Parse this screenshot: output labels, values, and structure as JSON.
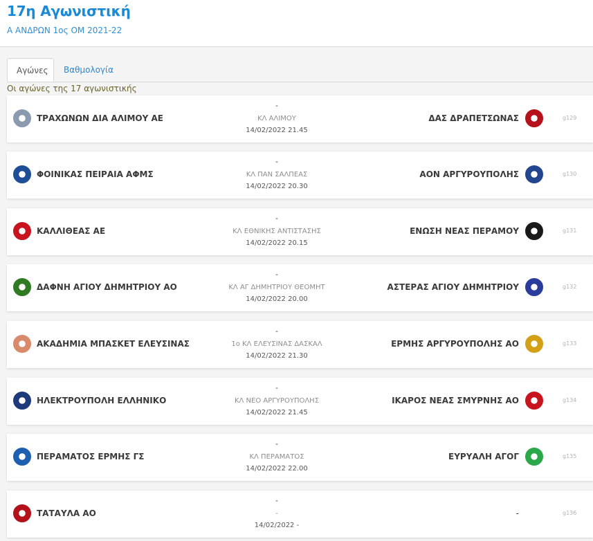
{
  "header": {
    "title": "17η Αγωνιστική",
    "subtitle": "Α ΑΝΔΡΩΝ 1ος ΟΜ 2021-22"
  },
  "tabs": [
    {
      "label": "Αγώνες",
      "active": true
    },
    {
      "label": "Βαθμολογία",
      "active": false
    }
  ],
  "games_caption": "Οι αγώνες της 17 αγωνιστικής",
  "matches": [
    {
      "home": "ΤΡΑΧΩΝΩΝ ΔΙΑ ΑΛΙΜΟΥ ΑΕ",
      "away": "ΔΑΣ ΔΡΑΠΕΤΣΩΝΑΣ",
      "score": "-",
      "venue": "ΚΛ ΑΛΙΜΟΥ",
      "datetime": "14/02/2022 21.45",
      "code": "g129",
      "home_icon": "trachones-logo-icon",
      "away_icon": "drapetsona-logo-icon",
      "home_color": "#8a9bb0",
      "away_color": "#b5121b"
    },
    {
      "home": "ΦΟΙΝΙΚΑΣ ΠΕΙΡΑΙΑ ΑΦΜΣ",
      "away": "ΑΟΝ ΑΡΓΥΡΟΥΠΟΛΗΣ",
      "score": "-",
      "venue": "ΚΛ ΠΑΝ ΣΑΛΠΕΑΣ",
      "datetime": "14/02/2022 20.30",
      "code": "g130",
      "home_icon": "foinikas-logo-icon",
      "away_icon": "aon-logo-icon",
      "home_color": "#1f4d96",
      "away_color": "#23468f"
    },
    {
      "home": "ΚΑΛΛΙΘΕΑΣ ΑΕ",
      "away": "ΕΝΩΣΗ ΝΕΑΣ ΠΕΡΑΜΟΥ",
      "score": "-",
      "venue": "ΚΛ ΕΘΝΙΚΗΣ ΑΝΤΙΣΤΑΣΗΣ",
      "datetime": "14/02/2022 20.15",
      "code": "g131",
      "home_icon": "kallithea-logo-icon",
      "away_icon": "enosi-perama-logo-icon",
      "home_color": "#c8141e",
      "away_color": "#1a1a1a"
    },
    {
      "home": "ΔΑΦΝΗ ΑΓΙΟΥ ΔΗΜΗΤΡΙΟΥ ΑΟ",
      "away": "ΑΣΤΕΡΑΣ ΑΓΙΟΥ ΔΗΜΗΤΡΙΟΥ",
      "score": "-",
      "venue": "ΚΛ ΑΓ ΔΗΜΗΤΡΙΟΥ ΘΕΟΜΗΤ",
      "datetime": "14/02/2022 20.00",
      "code": "g132",
      "home_icon": "dafni-logo-icon",
      "away_icon": "asteras-logo-icon",
      "home_color": "#2f7a22",
      "away_color": "#2c3c9c"
    },
    {
      "home": "ΑΚΑΔΗΜΙΑ ΜΠΑΣΚΕΤ ΕΛΕΥΣΙΝΑΣ",
      "away": "ΕΡΜΗΣ ΑΡΓΥΡΟΥΠΟΛΗΣ ΑΟ",
      "score": "-",
      "venue": "1ο ΚΛ ΕΛΕΥΣΙΝΑΣ ΔΑΣΚΑΛ",
      "datetime": "14/02/2022 21.30",
      "code": "g133",
      "home_icon": "akadimia-elefsinas-logo-icon",
      "away_icon": "ermis-argyroupolis-logo-icon",
      "home_color": "#d98a6b",
      "away_color": "#d4a017"
    },
    {
      "home": "ΗΛΕΚΤΡΟΥΠΟΛΗ ΕΛΛΗΝΙΚΟ",
      "away": "ΙΚΑΡΟΣ ΝΕΑΣ ΣΜΥΡΝΗΣ ΑΟ",
      "score": "-",
      "venue": "ΚΛ ΝΕΟ ΑΡΓΥΡΟΥΠΟΛΗΣ",
      "datetime": "14/02/2022 21.45",
      "code": "g134",
      "home_icon": "ilektroupoli-logo-icon",
      "away_icon": "ikaros-logo-icon",
      "home_color": "#1d3a7a",
      "away_color": "#c8141e"
    },
    {
      "home": "ΠΕΡΑΜΑΤΟΣ ΕΡΜΗΣ ΓΣ",
      "away": "ΕΥΡΥΑΛΗ ΑΓΟΓ",
      "score": "-",
      "venue": "ΚΛ ΠΕΡΑΜΑΤΟΣ",
      "datetime": "14/02/2022 22.00",
      "code": "g135",
      "home_icon": "perama-ermis-logo-icon",
      "away_icon": "evryali-logo-icon",
      "home_color": "#1f5fb0",
      "away_color": "#2aa84a"
    },
    {
      "home": "ΤΑΤΑΥΛΑ ΑΟ",
      "away": "",
      "away_placeholder": "-",
      "score": "-",
      "venue": "-",
      "datetime": "14/02/2022 -",
      "code": "g136",
      "home_icon": "tatavla-logo-icon",
      "away_icon": "",
      "home_color": "#b3121b",
      "away_color": ""
    }
  ]
}
